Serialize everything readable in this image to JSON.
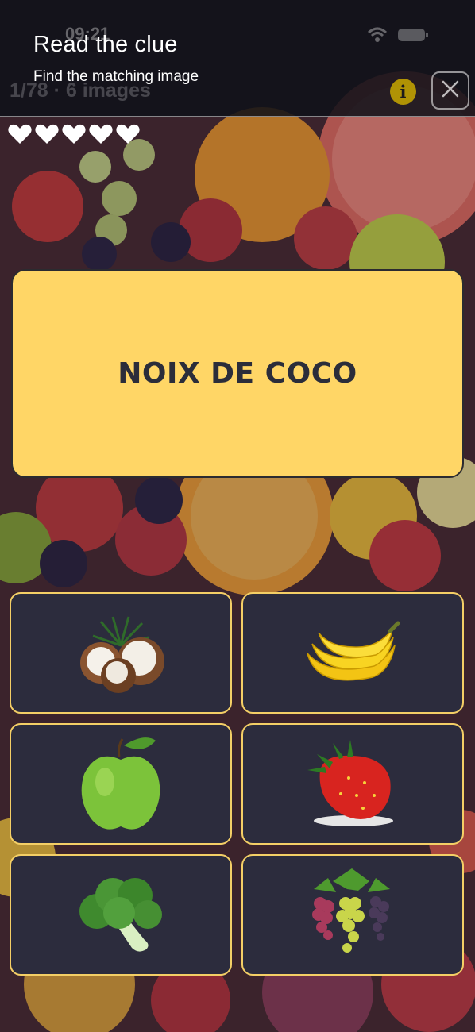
{
  "header": {
    "status_time": "09:21",
    "title": "Read the clue",
    "subtitle": "Find the matching image",
    "progress_ghost": "1/78 · 6 images",
    "info_label": "i"
  },
  "lives": {
    "total": 5,
    "remaining": 5
  },
  "clue": {
    "text": "NOIX DE COCO"
  },
  "choices": [
    {
      "icon": "coconut-image"
    },
    {
      "icon": "banana-image"
    },
    {
      "icon": "apple-image"
    },
    {
      "icon": "strawberry-image"
    },
    {
      "icon": "broccoli-image"
    },
    {
      "icon": "grapes-image"
    }
  ],
  "colors": {
    "clue_card": "#ffd666",
    "tile_bg": "#2c2c3d",
    "tile_border": "#f4cf66",
    "header_bg": "#0e1018"
  }
}
